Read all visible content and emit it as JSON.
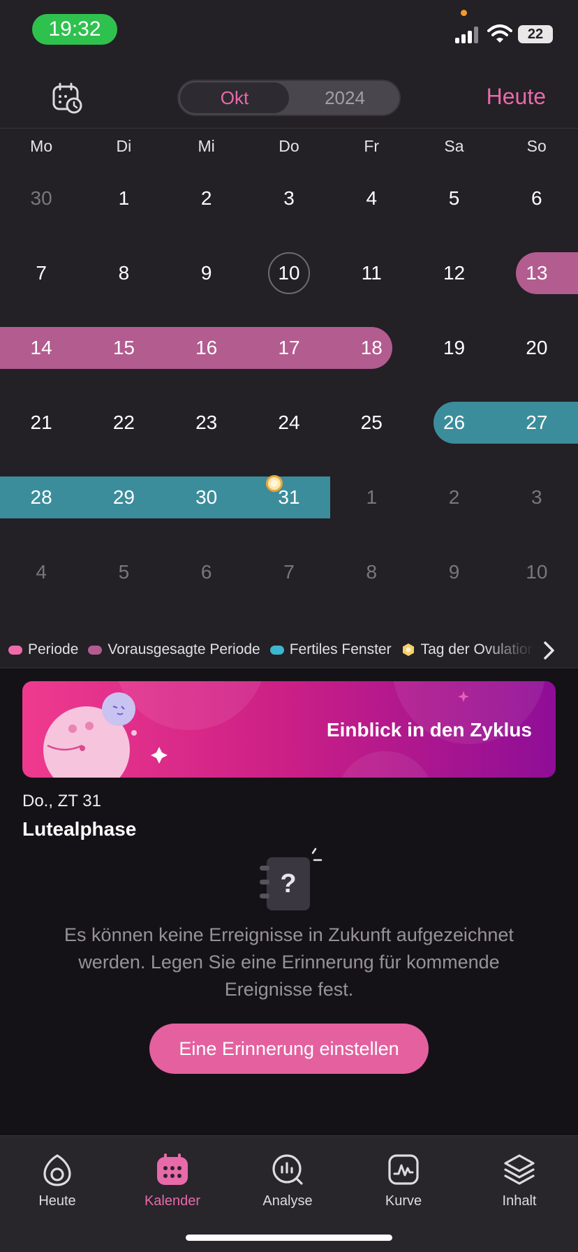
{
  "status_bar": {
    "time": "19:32",
    "battery": "22"
  },
  "header": {
    "month": "Okt",
    "year": "2024",
    "today_label": "Heute"
  },
  "weekdays": [
    "Mo",
    "Di",
    "Mi",
    "Do",
    "Fr",
    "Sa",
    "So"
  ],
  "calendar": {
    "weeks": [
      [
        {
          "d": "30",
          "dim": true
        },
        {
          "d": "1"
        },
        {
          "d": "2"
        },
        {
          "d": "3"
        },
        {
          "d": "4"
        },
        {
          "d": "5"
        },
        {
          "d": "6"
        }
      ],
      [
        {
          "d": "7"
        },
        {
          "d": "8"
        },
        {
          "d": "9"
        },
        {
          "d": "10",
          "today": true
        },
        {
          "d": "11"
        },
        {
          "d": "12"
        },
        {
          "d": "13",
          "state": "predicted"
        }
      ],
      [
        {
          "d": "14",
          "state": "predicted"
        },
        {
          "d": "15",
          "state": "predicted"
        },
        {
          "d": "16",
          "state": "predicted"
        },
        {
          "d": "17",
          "state": "predicted"
        },
        {
          "d": "18",
          "state": "predicted"
        },
        {
          "d": "19"
        },
        {
          "d": "20"
        }
      ],
      [
        {
          "d": "21"
        },
        {
          "d": "22"
        },
        {
          "d": "23"
        },
        {
          "d": "24"
        },
        {
          "d": "25"
        },
        {
          "d": "26",
          "state": "fertile"
        },
        {
          "d": "27",
          "state": "fertile"
        }
      ],
      [
        {
          "d": "28",
          "state": "fertile"
        },
        {
          "d": "29",
          "state": "fertile"
        },
        {
          "d": "30",
          "state": "fertile"
        },
        {
          "d": "31",
          "state": "fertile",
          "ovulation": true,
          "selected": true
        },
        {
          "d": "1",
          "dim": true
        },
        {
          "d": "2",
          "dim": true
        },
        {
          "d": "3",
          "dim": true
        }
      ],
      [
        {
          "d": "4",
          "dim": true
        },
        {
          "d": "5",
          "dim": true
        },
        {
          "d": "6",
          "dim": true
        },
        {
          "d": "7",
          "dim": true
        },
        {
          "d": "8",
          "dim": true
        },
        {
          "d": "9",
          "dim": true
        },
        {
          "d": "10",
          "dim": true
        }
      ]
    ]
  },
  "legend": {
    "items": [
      {
        "label": "Periode",
        "color": "#f06aa8",
        "shape": "pill"
      },
      {
        "label": "Vorausgesagte Periode",
        "color": "#b35c90",
        "shape": "pill"
      },
      {
        "label": "Fertiles Fenster",
        "color": "#3eb6cf",
        "shape": "pill"
      },
      {
        "label": "Tag der Ovulation",
        "color": "#f6cf6a",
        "shape": "hexagon"
      }
    ]
  },
  "banner": {
    "title": "Einblick in den Zyklus"
  },
  "day_info": {
    "day_label": "Do., ZT 31",
    "phase": "Lutealphase"
  },
  "empty_state": {
    "message": "Es können keine Erreignisse in Zukunft aufgezeichnet werden. Legen Sie eine Erinnerung für kommende Ereignisse fest.",
    "cta_label": "Eine Erinnerung einstellen"
  },
  "tabs": [
    {
      "label": "Heute",
      "icon": "today-icon",
      "active": false
    },
    {
      "label": "Kalender",
      "icon": "calendar-icon",
      "active": true
    },
    {
      "label": "Analyse",
      "icon": "analysis-icon",
      "active": false
    },
    {
      "label": "Kurve",
      "icon": "curve-icon",
      "active": false
    },
    {
      "label": "Inhalt",
      "icon": "content-icon",
      "active": false
    }
  ],
  "colors": {
    "accent": "#e86aa9",
    "predicted_period": "#b35c90",
    "fertile": "#3c8d9b",
    "background": "#232026"
  }
}
